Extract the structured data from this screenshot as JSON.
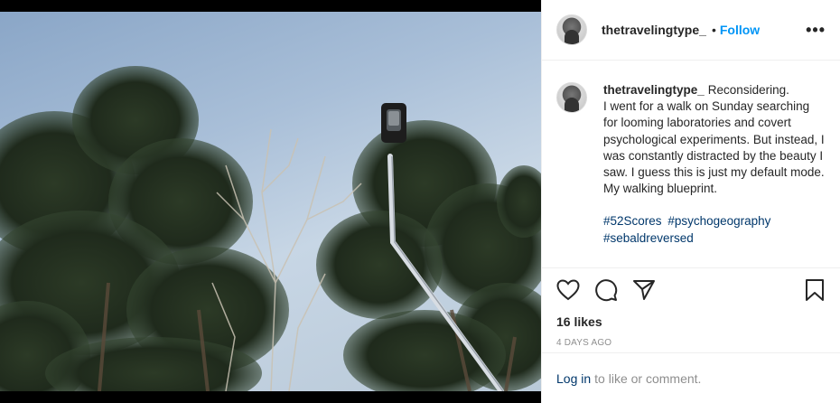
{
  "post": {
    "username": "thetravelingtype_",
    "follow_label": "Follow",
    "separator": "•",
    "more_label": "•••"
  },
  "caption": {
    "username": "thetravelingtype_",
    "text": "Reconsidering.\nI went for a walk on Sunday searching for looming laboratories and covert psychological experiments. But instead, I was constantly distracted by the beauty I saw. I guess this is just my default mode. My walking blueprint.",
    "hashtags": [
      "#52Scores",
      "#psychogeography",
      "#sebaldreversed"
    ]
  },
  "actions": {
    "like_icon": "heart-icon",
    "comment_icon": "comment-icon",
    "share_icon": "paper-plane-icon",
    "save_icon": "bookmark-icon"
  },
  "likes_text": "16 likes",
  "timestamp": "4 DAYS AGO",
  "footer": {
    "login_label": "Log in",
    "rest_text": "to like or comment."
  },
  "colors": {
    "link_blue": "#0095f6",
    "hashtag_blue": "#00376b",
    "text": "#262626",
    "muted": "#8e8e8e"
  }
}
